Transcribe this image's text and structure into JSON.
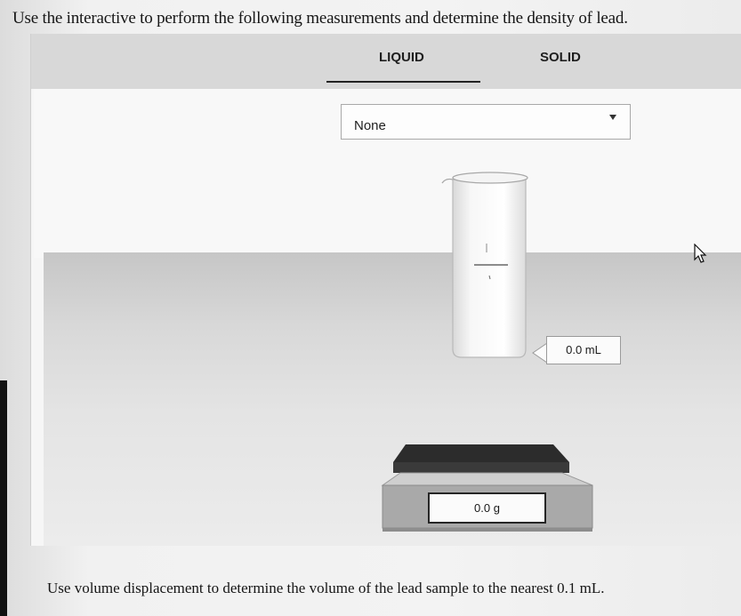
{
  "instructions": "Use the interactive to perform the following measurements and determine the density of lead.",
  "tabs": {
    "liquid": "LIQUID",
    "solid": "SOLID",
    "active": "LIQUID"
  },
  "dropdown": {
    "selected": "None"
  },
  "cylinder": {
    "volume_readout": "0.0 mL"
  },
  "balance": {
    "mass_readout": "0.0 g"
  },
  "footer": "Use volume displacement to determine the volume of the lead sample to the nearest 0.1 mL.",
  "icons": [
    "dropdown-arrow-icon",
    "pointer-cursor-icon"
  ],
  "colors": {
    "tabbar": "#d8d8d8",
    "panel": "#f6f6f6",
    "balance_pan": "#2f2f2f",
    "balance_body": "#a8a8a8"
  }
}
